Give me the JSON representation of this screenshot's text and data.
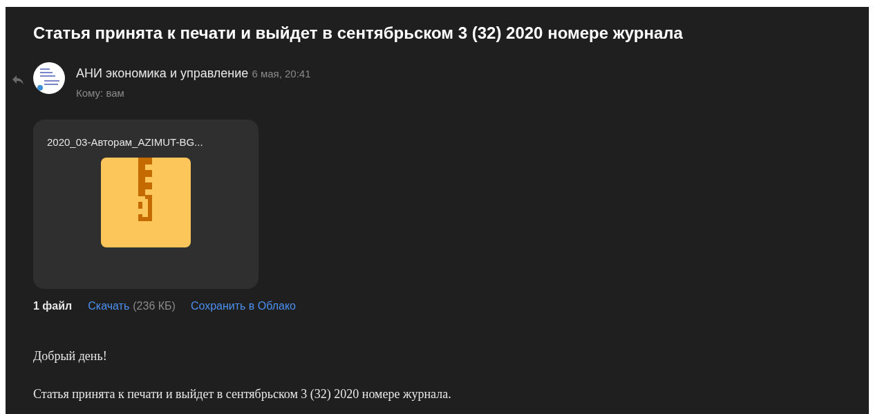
{
  "subject": "Статья принята к печати и выйдет в сентябрьском 3 (32) 2020 номере журнала",
  "sender": {
    "name": "АНИ экономика и управление",
    "date": "6 мая, 20:41",
    "to": "Кому: вам"
  },
  "attachments": [
    {
      "kind": "archive",
      "name": "2020_03-Авторам_AZIMUT-BG..."
    }
  ],
  "attachment_bar": {
    "count": "1 файл",
    "download": "Скачать",
    "size": "(236 КБ)",
    "save": "Сохранить в Облако"
  },
  "body": [
    "Добрый день!",
    "Статья принята к печати и выйдет в сентябрьском 3 (32) 2020 номере журнала."
  ]
}
